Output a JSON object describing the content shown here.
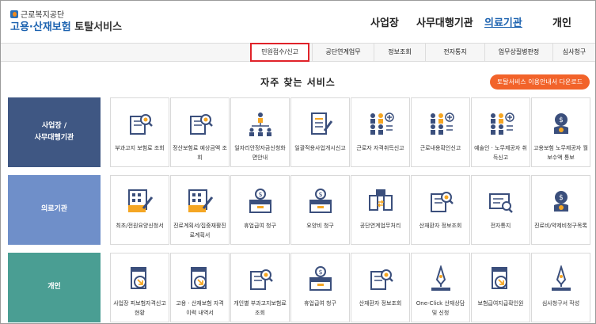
{
  "header": {
    "org_name": "근로복지공단",
    "title_part1": "고용·산재보험",
    "title_part2": "토탈서비스",
    "nav": [
      {
        "label": "사업장",
        "active": false
      },
      {
        "label": "사무대행기관",
        "active": false
      },
      {
        "label": "의료기관",
        "active": true
      },
      {
        "label": "개인",
        "active": false
      }
    ]
  },
  "subnav": [
    {
      "label": "민원접수/신고",
      "highlight": true
    },
    {
      "label": "공단연계업무",
      "highlight": false
    },
    {
      "label": "정보조회",
      "highlight": false
    },
    {
      "label": "전자통지",
      "highlight": false
    },
    {
      "label": "업무상질병판정",
      "highlight": false
    },
    {
      "label": "심사청구",
      "highlight": false
    }
  ],
  "section": {
    "title": "자주 찾는 서비스",
    "download_label": "토탈서비스 이용안내서 다운로드"
  },
  "rows": [
    {
      "title_line1": "사업장 /",
      "title_line2": "사무대행기관",
      "color": "#3f5783",
      "items": [
        {
          "label": "부과고지 보험료 조회",
          "icon": "document-search-icon"
        },
        {
          "label": "정산보험료 예상금액 조회",
          "icon": "document-search-icon"
        },
        {
          "label": "일자리안정자금신청화면안내",
          "icon": "org-chart-icon"
        },
        {
          "label": "일괄적용사업개시신고",
          "icon": "document-edit-icon"
        },
        {
          "label": "근로자 자격취득신고",
          "icon": "people-add-icon"
        },
        {
          "label": "근로내용확인신고",
          "icon": "people-add-icon"
        },
        {
          "label": "예술인 · 노무제공자 취득신고",
          "icon": "people-add-icon"
        },
        {
          "label": "고용보험 노무제공자 월보수액 통보",
          "icon": "money-bag-icon"
        }
      ]
    },
    {
      "title_line1": "의료기관",
      "title_line2": "",
      "color": "#6f8fc9",
      "items": [
        {
          "label": "최초/전원요양신청서",
          "icon": "form-pen-icon"
        },
        {
          "label": "진료계획서/집중재활진료계획서",
          "icon": "form-pen-icon"
        },
        {
          "label": "휴업급여 청구",
          "icon": "coin-box-icon"
        },
        {
          "label": "요양비 청구",
          "icon": "coin-box-icon"
        },
        {
          "label": "공단연계업무처리",
          "icon": "transfer-icon"
        },
        {
          "label": "산재환자 정보조회",
          "icon": "document-search-icon"
        },
        {
          "label": "전자통지",
          "icon": "notice-search-icon"
        },
        {
          "label": "진료비/약제비청구목록",
          "icon": "money-bag-icon"
        }
      ]
    },
    {
      "title_line1": "개인",
      "title_line2": "",
      "color": "#4a9e93",
      "items": [
        {
          "label": "사업장 피보험자격신고현황",
          "icon": "document-arrow-icon"
        },
        {
          "label": "고용 · 산재보험 자격 이력 내역서",
          "icon": "document-arrow-icon"
        },
        {
          "label": "개인별 부과고지보험료 조회",
          "icon": "document-search-icon"
        },
        {
          "label": "휴업급여 청구",
          "icon": "coin-box-icon"
        },
        {
          "label": "산재환자 정보조회",
          "icon": "document-search-icon"
        },
        {
          "label": "One-Click 산재상담 및 신청",
          "icon": "pen-nib-icon"
        },
        {
          "label": "보험급여지급확인원",
          "icon": "document-arrow-icon"
        },
        {
          "label": "심사청구서 작성",
          "icon": "pen-nib-icon"
        }
      ]
    }
  ],
  "colors": {
    "brand_blue": "#1d63b0",
    "accent_orange": "#f2632a",
    "highlight_red": "#e0232a",
    "icon_navy": "#3b4f7c",
    "icon_orange": "#f5a623"
  }
}
